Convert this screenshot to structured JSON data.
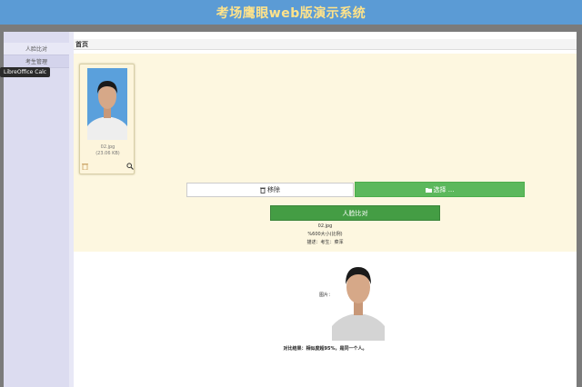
{
  "header": {
    "title": "考场鹰眼web版演示系统"
  },
  "sidebar": {
    "items": [
      {
        "label": "人脸比对"
      },
      {
        "label": "考生管理"
      }
    ]
  },
  "tooltip": {
    "text": "LibreOffice Calc"
  },
  "page": {
    "title": "首页"
  },
  "card": {
    "filename": "02.jpg",
    "filesize": "(23.06 KB)"
  },
  "buttons": {
    "remove_label": "移除",
    "choose_label": "选择 ...",
    "compare_label": "人脸比对"
  },
  "result": {
    "filename": "02.jpg",
    "size_text": "%600大小(比例)",
    "description": "描述：考生：菜浑",
    "image_label": "图片：",
    "conclusion": "对比结果：相似度超95%，是同一个人。"
  },
  "colors": {
    "header_bg": "#5b9bd5",
    "header_text": "#ffe38a",
    "choose_button": "#5cb85c",
    "compare_button": "#449d44",
    "upload_panel_bg": "#fdf7e0",
    "sidebar_bg": "#dcdcf0"
  },
  "icons": {
    "trash": "trash-icon",
    "zoom": "zoom-icon",
    "remove": "trash-icon",
    "choose": "folder-open-icon"
  }
}
